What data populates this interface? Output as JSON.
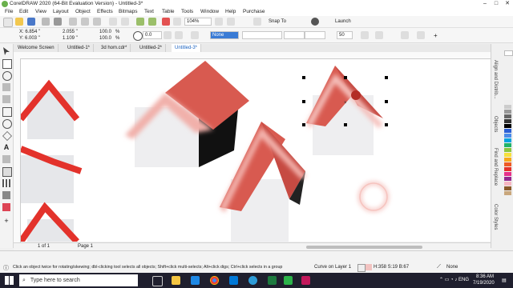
{
  "titlebar": {
    "title": "CorelDRAW 2020 (64-Bit Evaluation Version) - Untitled-3*",
    "minimize": "–",
    "maximize": "□",
    "close": "✕"
  },
  "menu": [
    "File",
    "Edit",
    "View",
    "Layout",
    "Object",
    "Effects",
    "Bitmaps",
    "Text",
    "Table",
    "Tools",
    "Window",
    "Help",
    "Purchase"
  ],
  "toolbar1": {
    "zoom": "104%",
    "snap_to": "Snap To",
    "launch": "Launch"
  },
  "property_bar": {
    "x": "X: 6.854 \"",
    "y": "Y: 6.003 \"",
    "w": "2.055 \"",
    "h": "1.109 \"",
    "scale_x": "100.0",
    "scale_y": "100.0",
    "pct": "%",
    "angle": "0.0",
    "fill_none": "None",
    "outline_value": "50"
  },
  "doc_tabs": [
    "Welcome Screen",
    "Untitled-1*",
    "3d hom.cdr*",
    "Untitled-2*",
    "Untitled-3*"
  ],
  "docker": {
    "labels": [
      "Align and Distrib...",
      "Objects",
      "Find and Replace",
      "Color Styles"
    ]
  },
  "page_bar": {
    "page": "Page 1",
    "nav": "1 of 1"
  },
  "status": {
    "hint": "Click an object twice for rotating/skewing; dbl-clicking tool selects all objects; Shift+click multi-selects; Alt+click digs; Ctrl+click selects in a group",
    "layer": "Curve on Layer 1",
    "color": "H:358 S:19 B:67",
    "outline": "None"
  },
  "taskbar": {
    "search_placeholder": "Type here to search",
    "time": "8:36 AM",
    "date": "7/19/2020",
    "lang": "ENG"
  },
  "colors": {
    "roof": "#d85a50",
    "roof_dark": "#a83a33",
    "wall": "#eeeef0",
    "selected_tab": "#1a62c0"
  },
  "icons": [
    "windows-icon",
    "search-icon",
    "task-view-icon",
    "file-explorer-icon",
    "chrome-icon",
    "store-icon",
    "edge-icon",
    "excel-icon",
    "coreldraw-icon"
  ]
}
